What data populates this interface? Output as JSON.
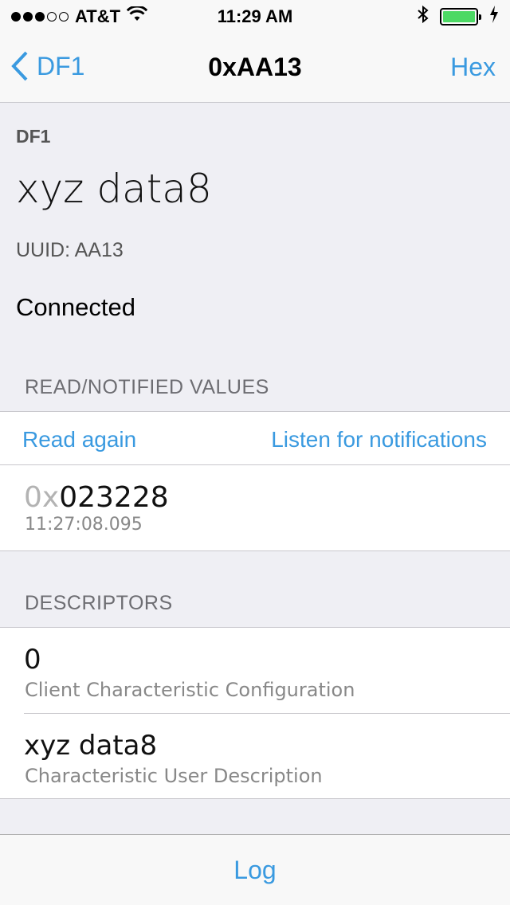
{
  "status_bar": {
    "carrier": "AT&T",
    "signal_bars_filled": 3,
    "signal_bars_total": 5,
    "time": "11:29 AM",
    "battery_level": 1.0,
    "battery_color": "#4cd964"
  },
  "nav": {
    "back_label": "DF1",
    "title": "0xAA13",
    "right_button": "Hex"
  },
  "header": {
    "service": "DF1",
    "characteristic_name": "xyz data8",
    "uuid": "UUID: AA13",
    "connection_status": "Connected"
  },
  "read_section": {
    "title": "READ/NOTIFIED VALUES",
    "read_again": "Read again",
    "listen": "Listen for notifications",
    "value_prefix": "0x",
    "value": "023228",
    "timestamp": "11:27:08.095"
  },
  "descriptors": {
    "title": "DESCRIPTORS",
    "items": [
      {
        "value": "0",
        "label": "Client Characteristic Configuration"
      },
      {
        "value": "xyz data8",
        "label": "Characteristic User Description"
      }
    ]
  },
  "toolbar": {
    "log": "Log"
  },
  "colors": {
    "accent": "#3a9ae0",
    "background": "#efeff4"
  }
}
